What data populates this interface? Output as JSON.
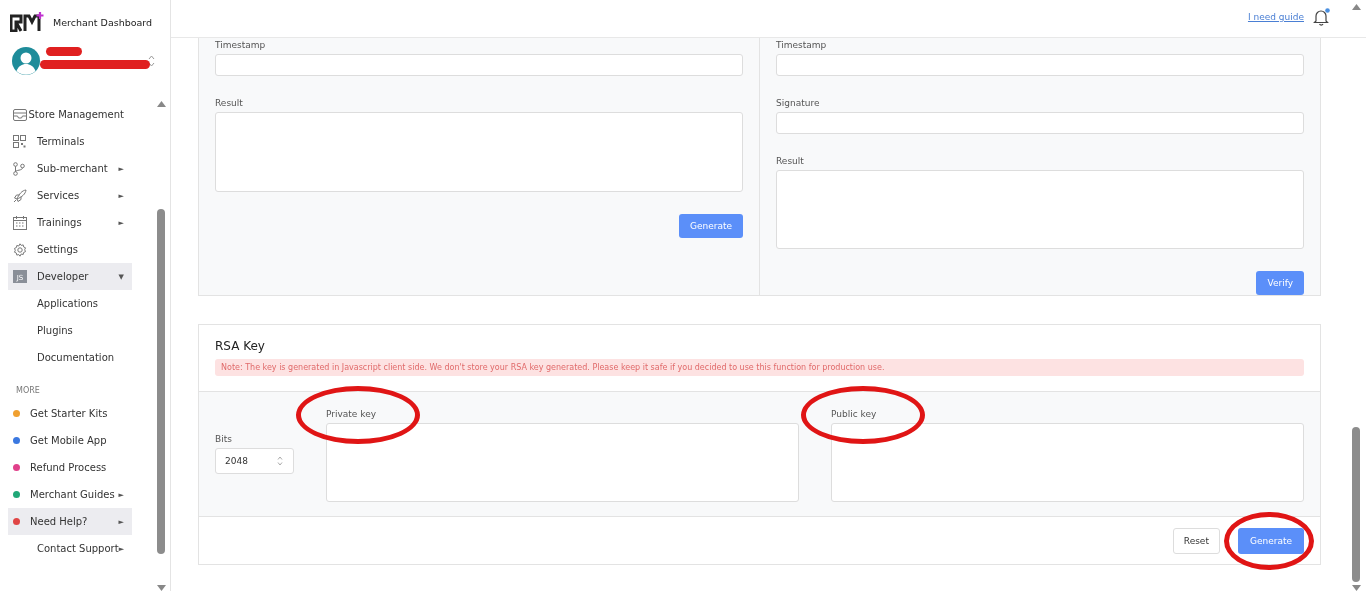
{
  "brand": {
    "title": "Merchant Dashboard"
  },
  "sidebar": {
    "items": [
      {
        "label": "Store Management",
        "kind": "store",
        "selected": false
      },
      {
        "label": "Terminals",
        "kind": "qr",
        "selected": false
      },
      {
        "label": "Sub-merchant",
        "kind": "branch",
        "arrow": "►",
        "selected": false
      },
      {
        "label": "Services",
        "kind": "rocket",
        "arrow": "►",
        "selected": false
      },
      {
        "label": "Trainings",
        "kind": "calendar",
        "arrow": "►",
        "selected": false
      },
      {
        "label": "Settings",
        "kind": "gear",
        "selected": false
      },
      {
        "label": "Developer",
        "kind": "js",
        "icon_text": "JS",
        "arrow": "▼",
        "selected": true,
        "children": [
          {
            "label": "Applications"
          },
          {
            "label": "Plugins"
          },
          {
            "label": "Documentation"
          }
        ]
      }
    ],
    "more_heading": "MORE",
    "more_items": [
      {
        "label": "Get Starter Kits",
        "color": "#f0a030",
        "selected": false
      },
      {
        "label": "Get Mobile App",
        "color": "#3b78e0",
        "selected": false
      },
      {
        "label": "Refund Process",
        "color": "#e0408a",
        "selected": false
      },
      {
        "label": "Merchant Guides",
        "color": "#20a878",
        "arrow": "►",
        "selected": false
      },
      {
        "label": "Need Help?",
        "color": "#e04545",
        "arrow": "►",
        "selected": true,
        "children": [
          {
            "label": "Contact Support",
            "arrow": "►"
          }
        ]
      }
    ]
  },
  "header": {
    "guide_link": "I need guide",
    "notification_dot": true
  },
  "sign_panel": {
    "fields": [
      {
        "label": "Timestamp",
        "kind": "input"
      },
      {
        "label": "Result",
        "kind": "textarea"
      }
    ],
    "button": "Generate"
  },
  "verify_panel": {
    "fields": [
      {
        "label": "Timestamp",
        "kind": "input"
      },
      {
        "label": "Signature",
        "kind": "input"
      },
      {
        "label": "Result",
        "kind": "textarea"
      }
    ],
    "button": "Verify"
  },
  "rsa": {
    "title": "RSA Key",
    "note": "Note: The key is generated in Javascript client side. We don't store your RSA key generated. Please keep it safe if you decided to use this function for production use.",
    "bits_label": "Bits",
    "bits_value": "2048",
    "private_key": {
      "label": "Private key",
      "circled": true
    },
    "public_key": {
      "label": "Public key",
      "circled": true
    },
    "reset": "Reset",
    "generate": {
      "label": "Generate",
      "circled": true
    }
  }
}
